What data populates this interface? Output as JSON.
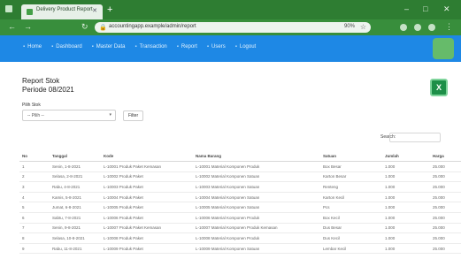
{
  "browser": {
    "tab_title": "Delivery Product Report",
    "new_tab_symbol": "+",
    "url": "accountingapp.example/admin/report",
    "zoom": "90%"
  },
  "app_nav": {
    "links": [
      {
        "label": "Home",
        "icon": "home-icon"
      },
      {
        "label": "Dashboard",
        "icon": "dashboard-icon"
      },
      {
        "label": "Master Data",
        "icon": "folder-icon"
      },
      {
        "label": "Transaction",
        "icon": "swap-icon"
      },
      {
        "label": "Report",
        "icon": "report-icon"
      },
      {
        "label": "Users",
        "icon": "users-icon"
      },
      {
        "label": "Logout",
        "icon": "logout-icon"
      }
    ]
  },
  "page": {
    "title_line1": "Report Stok",
    "title_line2": "Periode 08/2021",
    "excel_icon_letter": "X",
    "filter_label": "Pilih Stok",
    "filter_value": "-- Pilih --",
    "filter_button": "Filter",
    "search_label": "Search:"
  },
  "table": {
    "headers": [
      "No",
      "Tanggal",
      "Kode",
      "Nama Barang",
      "Satuan",
      "Jumlah",
      "Harga"
    ],
    "rows": [
      [
        "1",
        "Senin, 1-8-2021",
        "L-10001 Produk Paket Kemasan",
        "L-10001 Material Komponen Produk",
        "Box Besar",
        "1.000",
        "25.000"
      ],
      [
        "2",
        "Selasa, 2-8-2021",
        "L-10002 Produk Paket",
        "L-10002 Material Komponen Satuan",
        "Karton Besar",
        "1.000",
        "25.000"
      ],
      [
        "3",
        "Rabu, 4-8-2021",
        "L-10003 Produk Paket",
        "L-10003 Material Komponen Satuan",
        "Renteng",
        "1.000",
        "25.000"
      ],
      [
        "4",
        "Kamis, 5-8-2021",
        "L-10004 Produk Paket",
        "L-10004 Material Komponen Satuan",
        "Karton Kecil",
        "1.000",
        "25.000"
      ],
      [
        "5",
        "Jumat, 6-8-2021",
        "L-10005 Produk Paket",
        "L-10005 Material Komponen Satuan",
        "Pcs",
        "1.000",
        "25.000"
      ],
      [
        "6",
        "Sabtu, 7-8-2021",
        "L-10006 Produk Paket",
        "L-10006 Material Komponen Produk",
        "Box Kecil",
        "1.000",
        "25.000"
      ],
      [
        "7",
        "Senin, 9-8-2021",
        "L-10007 Produk Paket Kemasan",
        "L-10007 Material Komponen Produk Kemasan",
        "Dus Besar",
        "1.000",
        "25.000"
      ],
      [
        "8",
        "Selasa, 10-8-2021",
        "L-10008 Produk Paket",
        "L-10008 Material Komponen Produk",
        "Dus Kecil",
        "1.000",
        "25.000"
      ],
      [
        "9",
        "Rabu, 11-8-2021",
        "L-10009 Produk Paket",
        "L-10009 Material Komponen Satuan",
        "Lembar Kecil",
        "1.000",
        "25.000"
      ]
    ]
  }
}
